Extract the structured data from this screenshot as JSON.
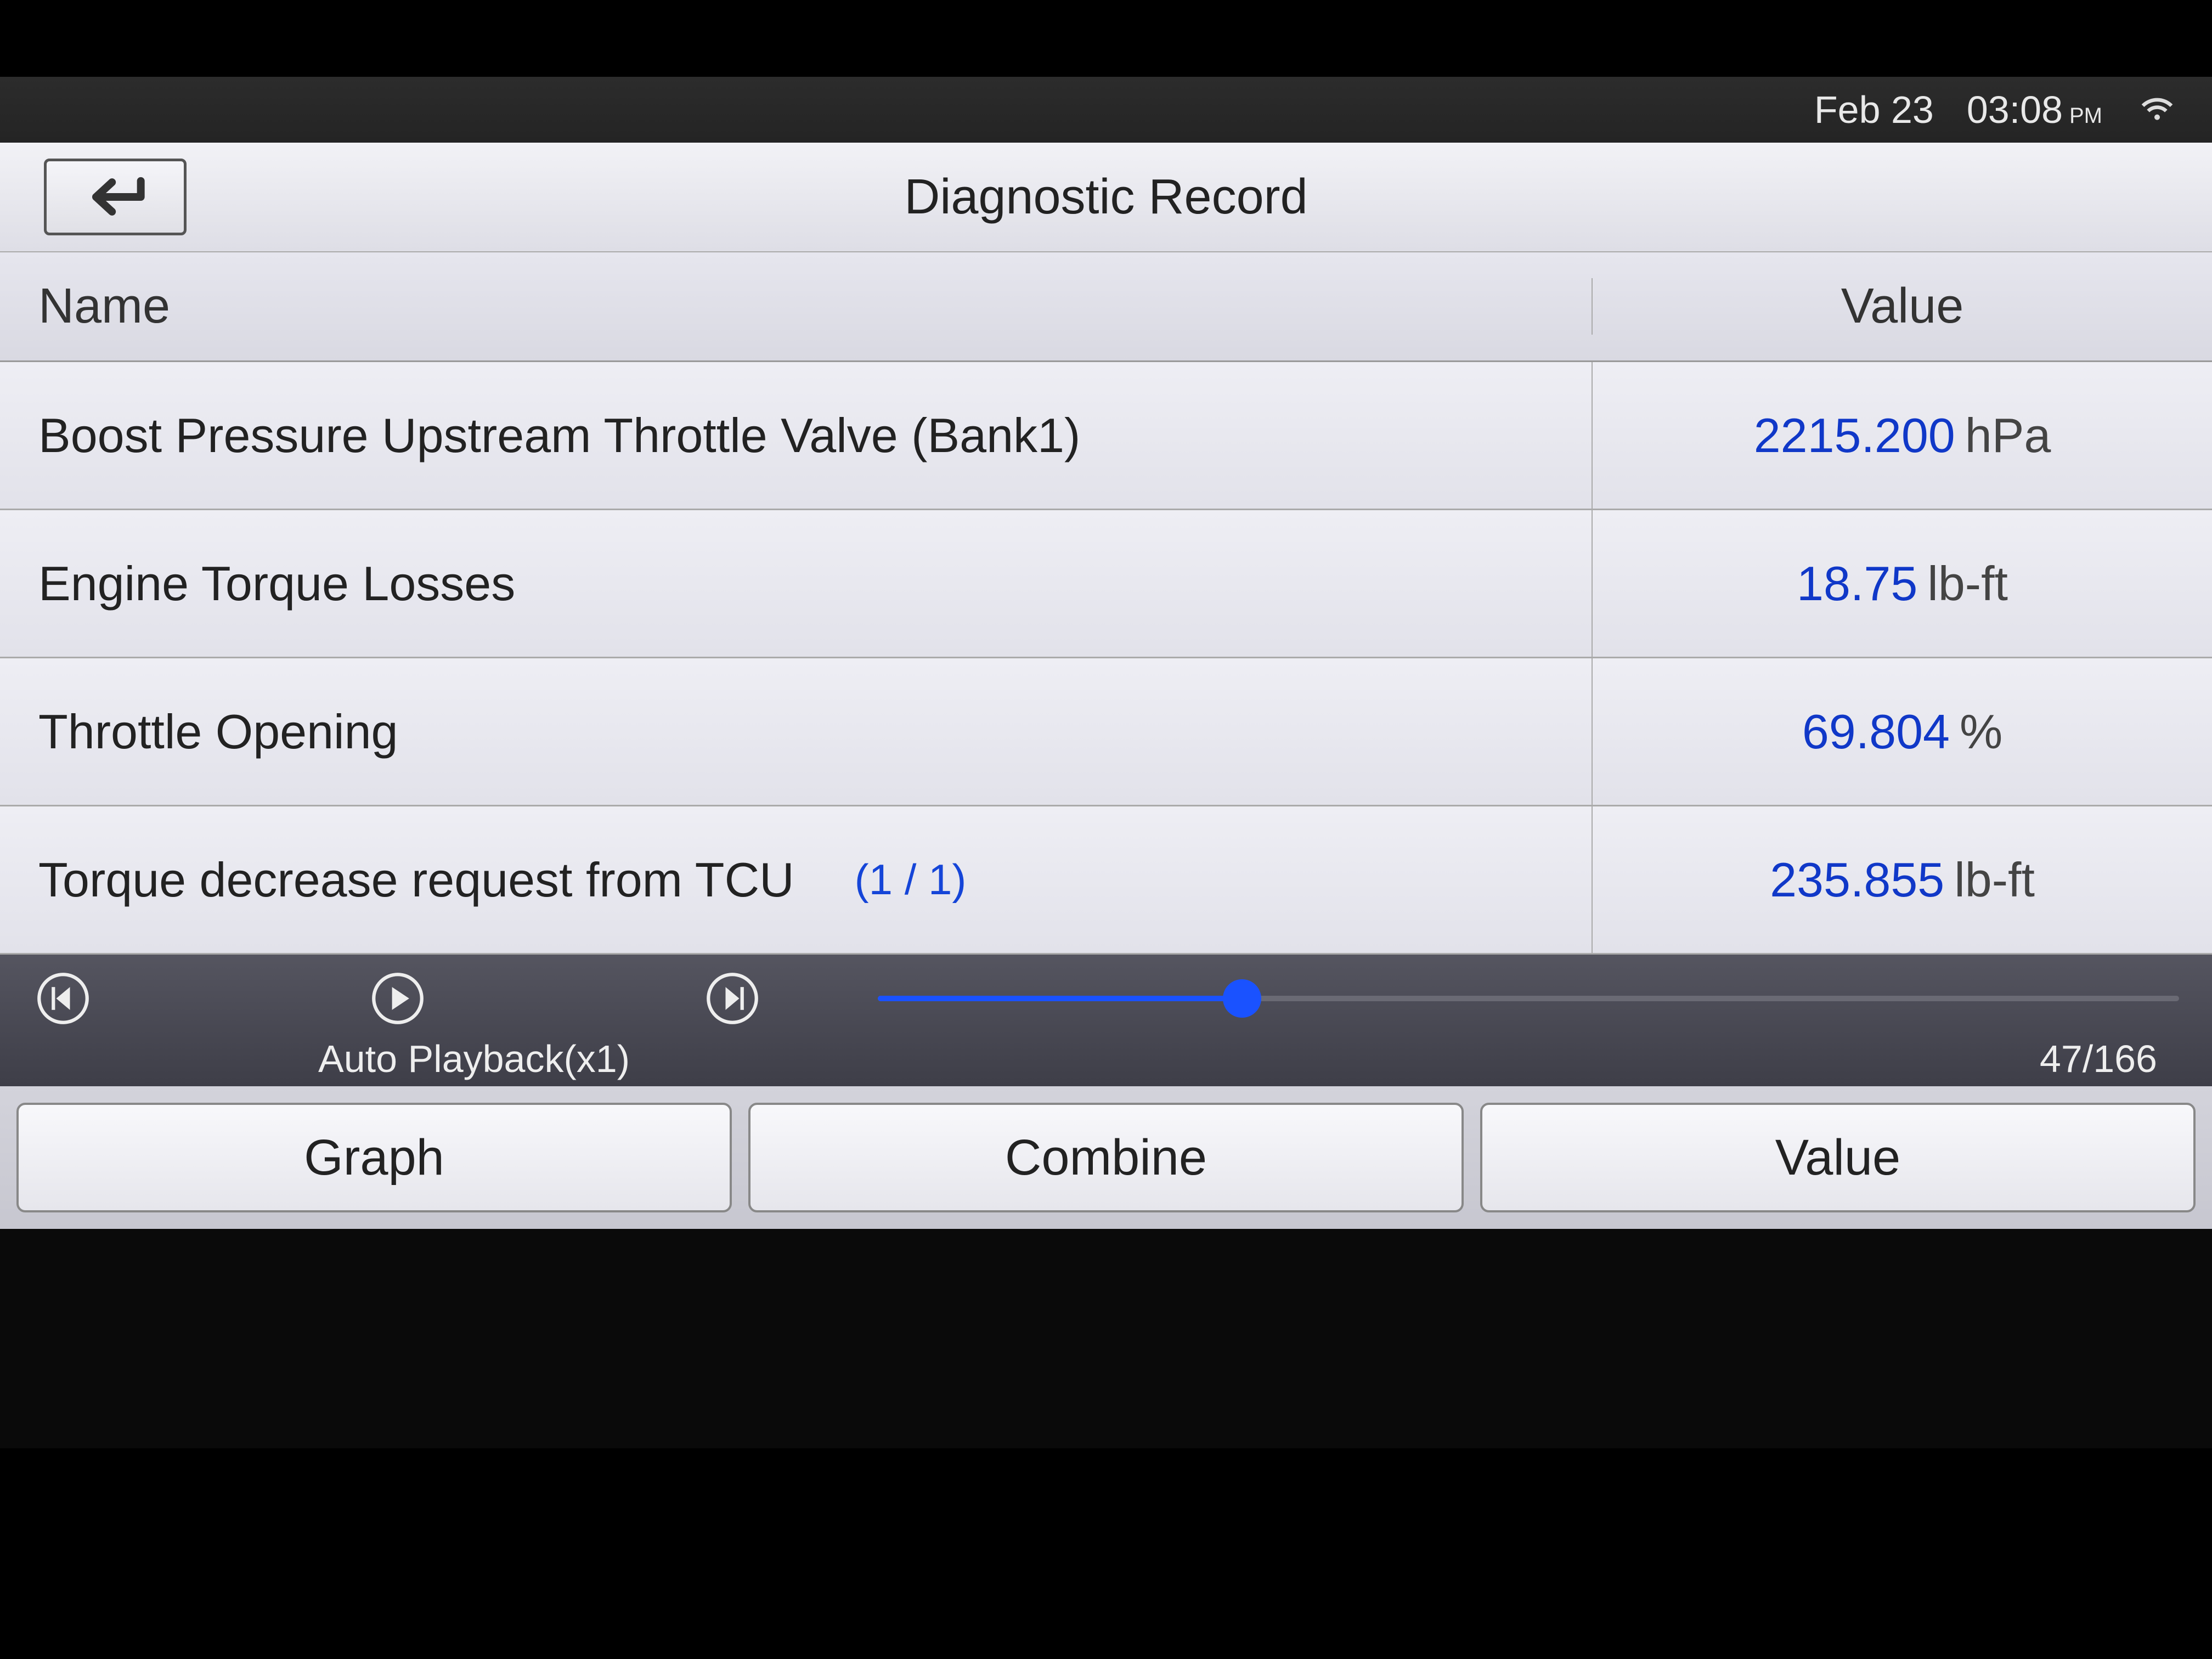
{
  "statusbar": {
    "date": "Feb 23",
    "time": "03:08",
    "ampm": "PM"
  },
  "header": {
    "title": "Diagnostic Record"
  },
  "table": {
    "headers": {
      "name": "Name",
      "value": "Value"
    },
    "rows": [
      {
        "name": "Boost Pressure Upstream Throttle Valve (Bank1)",
        "value": "2215.200",
        "unit": "hPa"
      },
      {
        "name": "Engine Torque Losses",
        "value": "18.75",
        "unit": "lb-ft"
      },
      {
        "name": "Throttle Opening",
        "value": "69.804",
        "unit": "%"
      },
      {
        "name": "Torque decrease request from TCU",
        "value": "235.855",
        "unit": "lb-ft",
        "frame": "(1 / 1)"
      }
    ]
  },
  "playback": {
    "mode_label": "Auto Playback(x1)",
    "position": "47/166"
  },
  "bottom": {
    "graph": "Graph",
    "combine": "Combine",
    "value": "Value"
  }
}
